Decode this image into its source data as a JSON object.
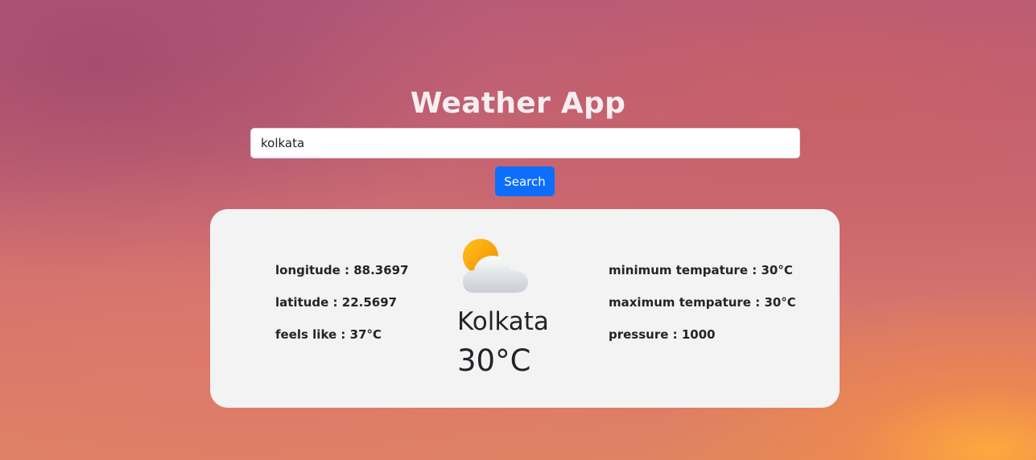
{
  "app": {
    "title": "Weather App"
  },
  "search": {
    "value": "kolkata",
    "button_label": "Search"
  },
  "weather": {
    "icon": "partly-cloudy-icon",
    "city": "Kolkata",
    "temperature": "30°C",
    "left_stats": [
      {
        "label": "longitude : ",
        "value": "88.3697"
      },
      {
        "label": "latitude : ",
        "value": "22.5697"
      },
      {
        "label": "feels like : ",
        "value": "37°C"
      }
    ],
    "right_stats": [
      {
        "label": "minimum tempature : ",
        "value": "30°C"
      },
      {
        "label": "maximum tempature : ",
        "value": "30°C"
      },
      {
        "label": "pressure : ",
        "value": "1000"
      }
    ]
  },
  "colors": {
    "button": "#0d6efd",
    "card": "#f3f3f3",
    "sun": "#f5a300"
  }
}
